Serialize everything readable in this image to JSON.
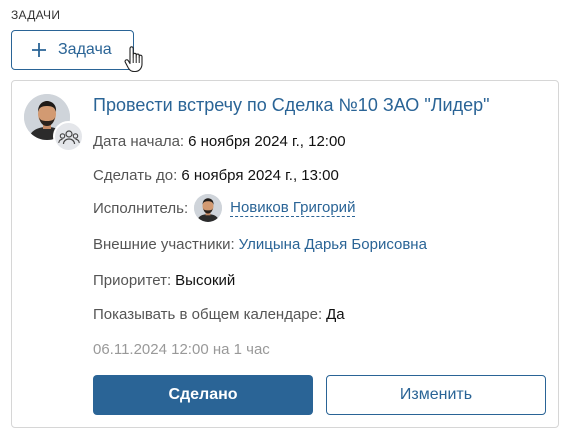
{
  "section": {
    "title": "ЗАДАЧИ"
  },
  "toolbar": {
    "add_task_label": "Задача",
    "plus_icon": "plus-icon",
    "cursor_icon": "hand-pointer-icon"
  },
  "task": {
    "title": "Провести встречу по Сделка №10 ЗАО \"Лидер\"",
    "start": {
      "label": "Дата начала:",
      "value": "6 ноября 2024 г., 12:00"
    },
    "due": {
      "label": "Сделать до:",
      "value": "6 ноября 2024 г., 13:00"
    },
    "assignee": {
      "label": "Исполнитель:",
      "value": "Новиков Григорий"
    },
    "external": {
      "label": "Внешние участники:",
      "value": "Улицына Дарья Борисовна"
    },
    "priority": {
      "label": "Приоритет:",
      "value": "Высокий"
    },
    "calendar": {
      "label": "Показывать в общем календаре:",
      "value": "Да"
    },
    "meta": "06.11.2024 12:00 на 1 час",
    "done_label": "Сделано",
    "edit_label": "Изменить"
  },
  "colors": {
    "accent": "#2a6496",
    "muted": "#999999",
    "border": "#d6d6d6"
  }
}
